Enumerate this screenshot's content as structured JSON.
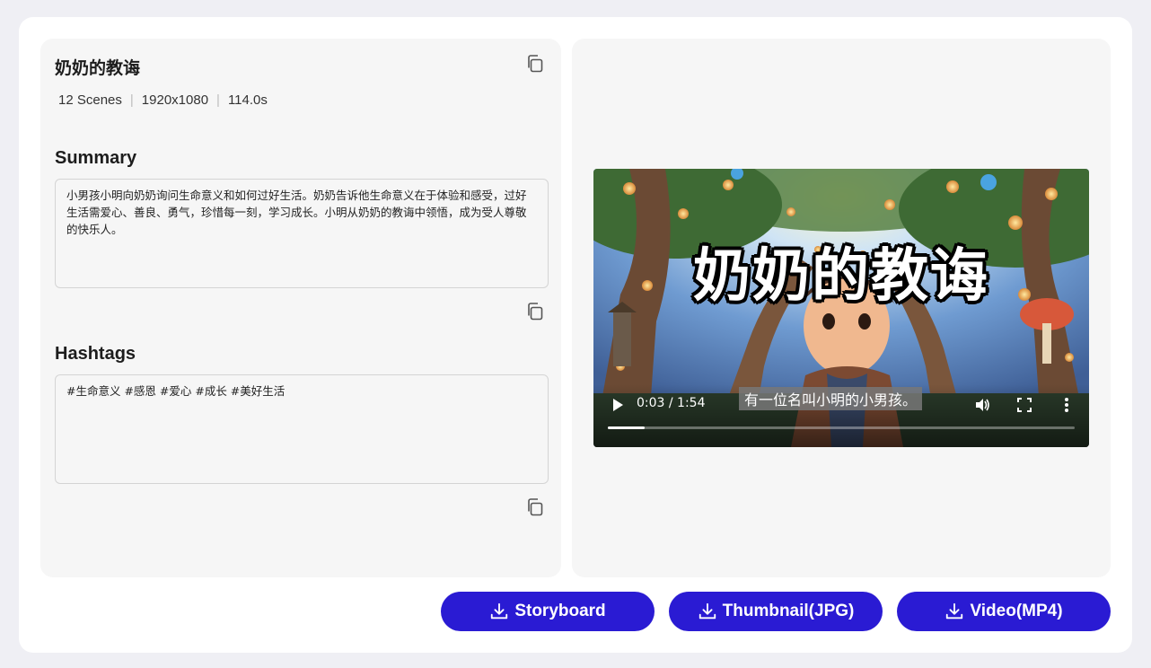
{
  "project": {
    "title": "奶奶的教诲",
    "scenes": "12 Scenes",
    "resolution": "1920x1080",
    "duration": "114.0s"
  },
  "summary": {
    "heading": "Summary",
    "text": "小男孩小明向奶奶询问生命意义和如何过好生活。奶奶告诉他生命意义在于体验和感受，过好生活需爱心、善良、勇气，珍惜每一刻，学习成长。小明从奶奶的教诲中领悟，成为受人尊敬的快乐人。"
  },
  "hashtags": {
    "heading": "Hashtags",
    "text": "#生命意义 #感恩 #爱心 #成长 #美好生活"
  },
  "video": {
    "overlay_title": "奶奶的教诲",
    "subtitle": "有一位名叫小明的小男孩。",
    "time": "0:03 / 1:54",
    "progress": 0.026
  },
  "buttons": {
    "storyboard": "Storyboard",
    "thumbnail": "Thumbnail(JPG)",
    "video": "Video(MP4)"
  },
  "colors": {
    "accent": "#2a1bd3",
    "panel": "#f6f6f6",
    "page_bg": "#efeff4"
  }
}
